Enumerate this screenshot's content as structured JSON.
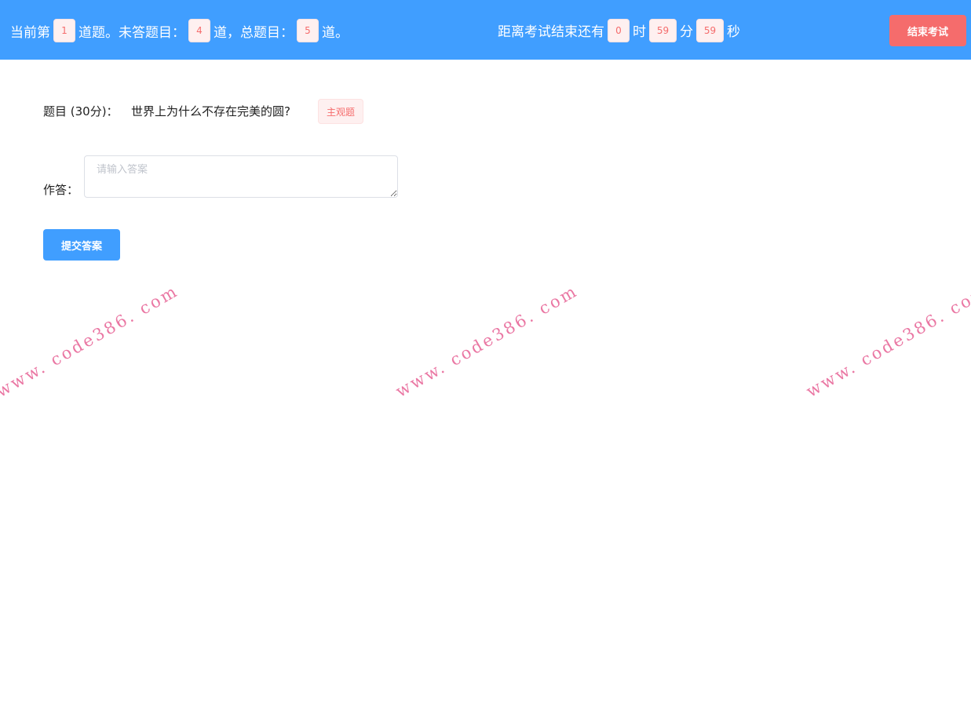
{
  "header": {
    "status_prefix": "当前第",
    "current_number": "1",
    "status_mid1": "道题。未答题目：",
    "unanswered_count": "4",
    "status_mid2": "道，总题目：",
    "total_count": "5",
    "status_suffix": "道。",
    "timer_prefix": "距离考试结束还有",
    "hours": "0",
    "hours_unit": "时",
    "minutes": "59",
    "minutes_unit": "分",
    "seconds": "59",
    "seconds_unit": "秒",
    "end_button_label": "结束考试"
  },
  "question": {
    "label": "题目 (30分)：",
    "text": "世界上为什么不存在完美的圆?",
    "type_tag": "主观题"
  },
  "answer": {
    "label": "作答：",
    "value": "",
    "placeholder": "请输入答案"
  },
  "submit_label": "提交答案",
  "watermark": {
    "text": "www. code386. com"
  },
  "colors": {
    "primary": "#409eff",
    "danger": "#f56c6c",
    "tag_bg": "#fef0f0",
    "watermark": "#e8699a"
  }
}
